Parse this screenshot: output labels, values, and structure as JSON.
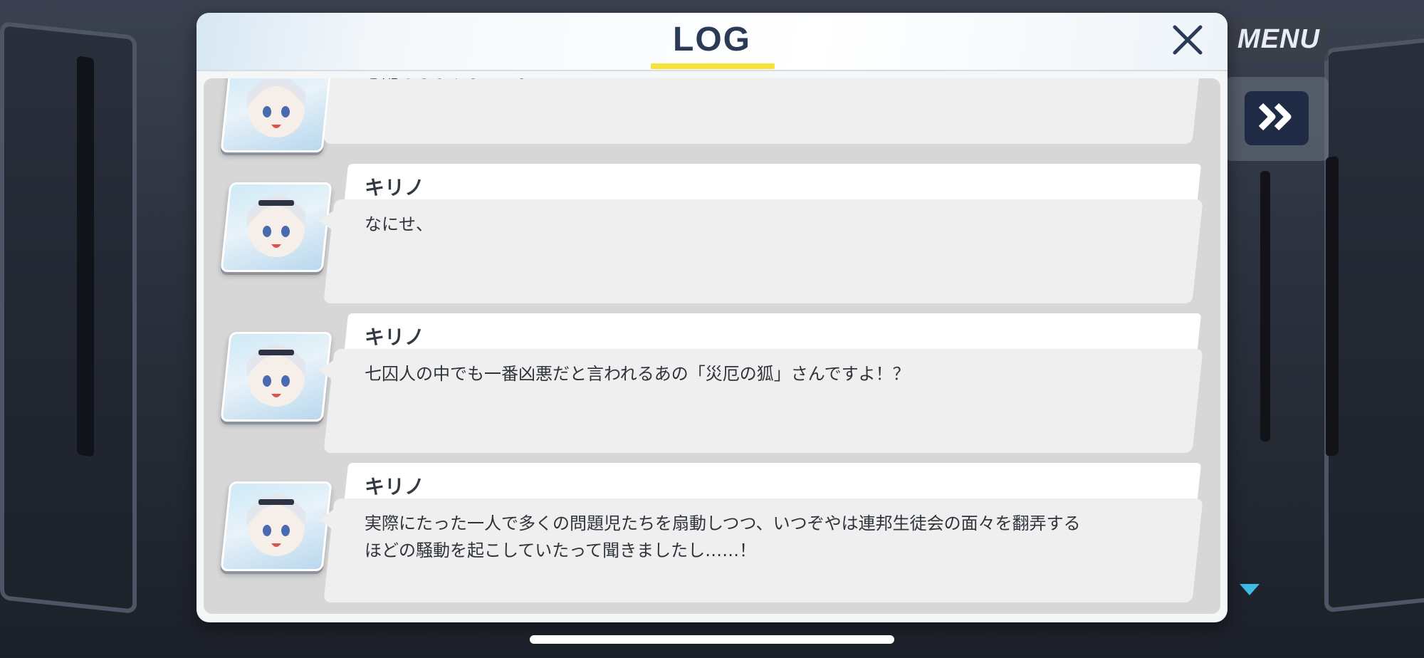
{
  "window": {
    "title": "LOG"
  },
  "controls": {
    "menu_label": "MENU",
    "skip_icon": "double-chevron-right-icon",
    "close_icon": "close-icon"
  },
  "colors": {
    "title_underline": "#f4e43a",
    "accent_blue": "#3fb9e6",
    "skip_button": "#1f2a44"
  },
  "log": {
    "entries": [
      {
        "speaker": "",
        "avatar": "kirino-portrait",
        "lines": [
          "心配もしますよ……。"
        ]
      },
      {
        "speaker": "キリノ",
        "avatar": "kirino-portrait",
        "lines": [
          "なにせ、"
        ]
      },
      {
        "speaker": "キリノ",
        "avatar": "kirino-portrait",
        "lines": [
          "七囚人の中でも一番凶悪だと言われるあの「災厄の狐」さんですよ！？"
        ]
      },
      {
        "speaker": "キリノ",
        "avatar": "kirino-portrait",
        "lines": [
          "実際にたった一人で多くの問題児たちを扇動しつつ、いつぞやは連邦生徒会の面々を翻弄する",
          "ほどの騒動を起こしていたって聞きましたし……！"
        ]
      }
    ]
  }
}
